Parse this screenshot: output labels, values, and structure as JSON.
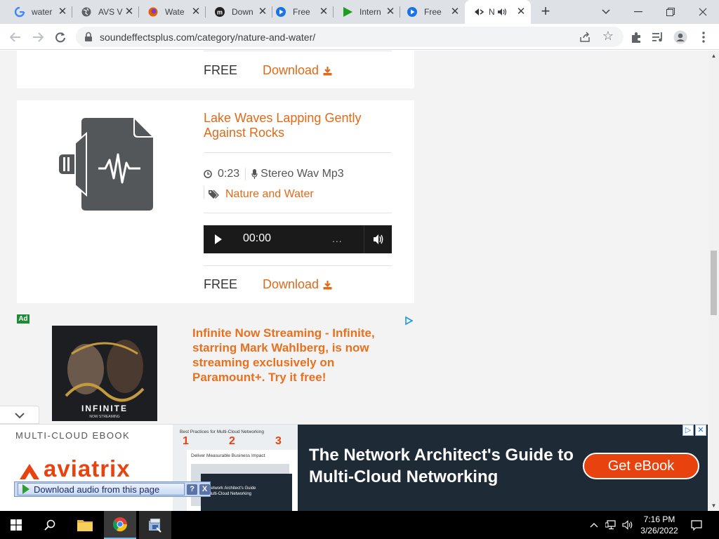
{
  "browser": {
    "tabs": [
      {
        "title": "water",
        "icon": "google-icon"
      },
      {
        "title": "AVS V",
        "icon": "globe-icon"
      },
      {
        "title": "Wate",
        "icon": "firefox-icon"
      },
      {
        "title": "Down",
        "icon": "m-icon"
      },
      {
        "title": "Free",
        "icon": "play-circle-icon"
      },
      {
        "title": "Intern",
        "icon": "play-triangle-icon"
      },
      {
        "title": "Free",
        "icon": "play-circle-icon"
      },
      {
        "title": "N",
        "icon": "speaker-icon",
        "active": true
      }
    ],
    "url": "soundeffectsplus.com/category/nature-and-water/"
  },
  "page": {
    "prev_card": {
      "price": "FREE",
      "download": "Download"
    },
    "card": {
      "title": "Lake Waves Lapping Gently Against Rocks",
      "duration": "0:23",
      "format": "Stereo Wav Mp3",
      "category": "Nature and Water",
      "player_time": "00:00",
      "player_dots": "...",
      "price": "FREE",
      "download": "Download"
    },
    "ad": {
      "label": "Ad",
      "poster_title": "INFINITE",
      "poster_sub": "NOW STREAMING",
      "text": "Infinite Now Streaming - Infinite, starring Mark Wahlberg, is now streaming exclusively on Paramount+. Try it free!"
    },
    "banner": {
      "ebook": "MULTI-CLOUD EBOOK",
      "brand": "aviatrix",
      "shot_lines": [
        "Best Practices for Multi-Cloud Networking",
        "Deliver Measurable Business Impact",
        "Network Architect's Guide",
        "Multi-Cloud Networking"
      ],
      "headline": "The Network Architect's Guide to Multi-Cloud Networking",
      "cta": "Get eBook"
    },
    "download_bar": {
      "label": "Download audio from this page",
      "help": "?",
      "close": "X"
    }
  },
  "taskbar": {
    "time": "7:16 PM",
    "date": "3/26/2022"
  },
  "colors": {
    "accent": "#e06a18",
    "ad_orange": "#e8701f",
    "aviatrix": "#e8420f"
  }
}
